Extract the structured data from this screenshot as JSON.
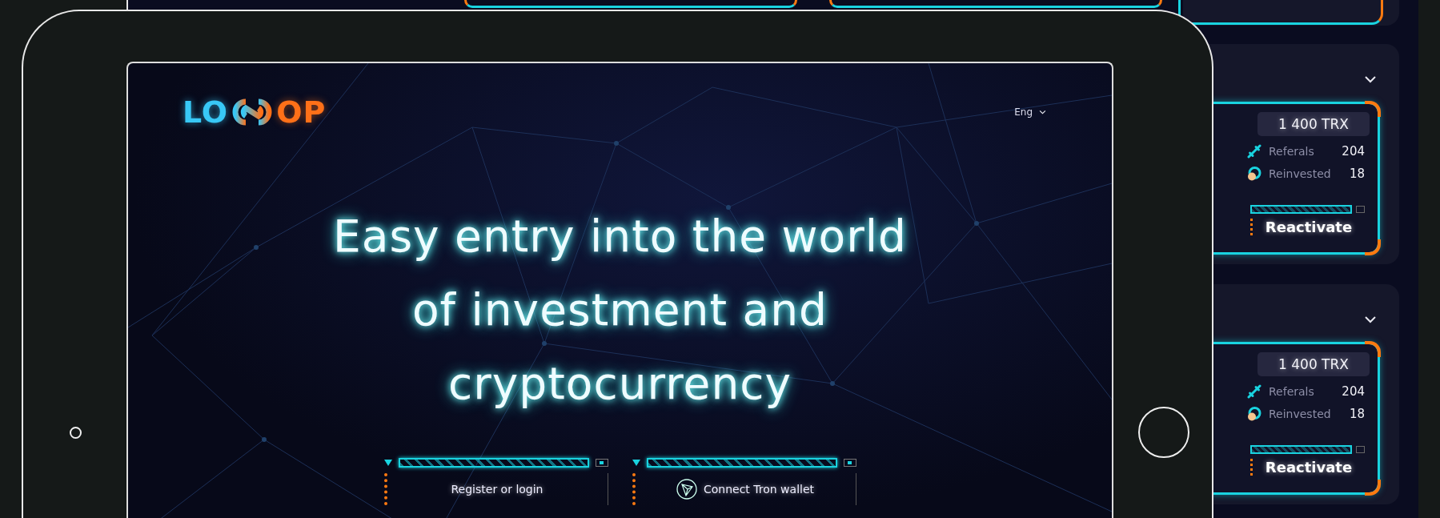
{
  "background_page": {
    "cards": [
      {
        "amount": "1 400 TRX",
        "stats": [
          {
            "kind": "link",
            "label": "Referals",
            "value": "204"
          },
          {
            "kind": "reinvest",
            "label": "Reinvested",
            "value": "18"
          }
        ],
        "button": "Reactivate"
      },
      {
        "amount": "1 400 TRX",
        "stats": [
          {
            "kind": "link",
            "label": "Referals",
            "value": "204"
          },
          {
            "kind": "reinvest",
            "label": "Reinvested",
            "value": "18"
          }
        ],
        "button": "Reactivate"
      }
    ]
  },
  "tablet": {
    "logo": {
      "left": "LO",
      "right": "OP"
    },
    "language": "Eng",
    "headline": "Easy entry into the world of investment and cryptocurrency",
    "actions": [
      {
        "kind": "plain",
        "label": "Register or login"
      },
      {
        "kind": "tron",
        "label": "Connect Tron wallet"
      }
    ]
  }
}
